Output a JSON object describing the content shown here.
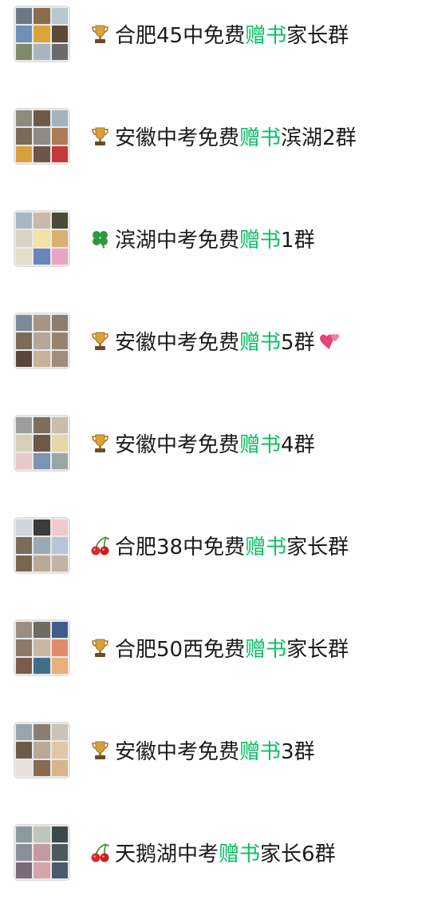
{
  "groups": [
    {
      "emoji": "trophy-icon",
      "pre": "合肥45中免费",
      "hl": "赠书",
      "post": "家长群",
      "suffix": "",
      "tiles": [
        "#6b7a86",
        "#8a6d4b",
        "#b9c7cf",
        "#6e8fb8",
        "#d9a53a",
        "#5a4a3a",
        "#7e8a6a",
        "#a9b4bf",
        "#6b6b6b"
      ]
    },
    {
      "emoji": "trophy-icon",
      "pre": "安徽中考免费",
      "hl": "赠书",
      "post": "滨湖2群",
      "suffix": "",
      "tiles": [
        "#8f8a7a",
        "#6f5a4a",
        "#a3b3c0",
        "#7a6a58",
        "#8c8c84",
        "#b07a55",
        "#d8a03a",
        "#6d5648",
        "#c23a3a"
      ]
    },
    {
      "emoji": "clover-icon",
      "pre": "滨湖中考免费",
      "hl": "赠书",
      "post": "1群",
      "suffix": "",
      "tiles": [
        "#a7b6c3",
        "#c9b9a7",
        "#4a4a3a",
        "#d7d2c4",
        "#f1e3a8",
        "#d8b070",
        "#e5ddc9",
        "#6a86b8",
        "#e7a6c4"
      ]
    },
    {
      "emoji": "trophy-icon",
      "pre": "安徽中考免费",
      "hl": "赠书",
      "post": "5群",
      "suffix": "two-hearts-icon",
      "tiles": [
        "#7a8a98",
        "#a49584",
        "#8b7d70",
        "#7c6a5a",
        "#b3a79a",
        "#96836f",
        "#5a4636",
        "#c7b19a",
        "#a08c7a"
      ]
    },
    {
      "emoji": "trophy-icon",
      "pre": "安徽中考免费",
      "hl": "赠书",
      "post": "4群",
      "suffix": "",
      "tiles": [
        "#9a9f9a",
        "#7d6e5e",
        "#c8bda8",
        "#d9cfb8",
        "#6a5a4a",
        "#e6d7a6",
        "#e9c7c8",
        "#7e93b0",
        "#9aa5a8"
      ]
    },
    {
      "emoji": "cherries-icon",
      "pre": "合肥38中免费",
      "hl": "赠书",
      "post": "家长群",
      "suffix": "",
      "tiles": [
        "#cfd5d8",
        "#3b3b3b",
        "#f0c9cf",
        "#7c6a5a",
        "#9aa9b5",
        "#b7c6d6",
        "#7a6650",
        "#b9a996",
        "#c3b3a4"
      ]
    },
    {
      "emoji": "trophy-icon",
      "pre": "合肥50西免费",
      "hl": "赠书",
      "post": "家长群",
      "suffix": "",
      "tiles": [
        "#9a8e80",
        "#6f6a62",
        "#3f5f8a",
        "#8c7a6a",
        "#c7b8a4",
        "#e08a6a",
        "#7a5c4a",
        "#3f6f8f",
        "#e7b07a"
      ]
    },
    {
      "emoji": "trophy-icon",
      "pre": "安徽中考免费",
      "hl": "赠书",
      "post": "3群",
      "suffix": "",
      "tiles": [
        "#9aa4ac",
        "#8a7e72",
        "#c9c3b9",
        "#6a5a4a",
        "#b8a996",
        "#e0c7a8",
        "#e8e0d8",
        "#8a6a50",
        "#d7b48a"
      ]
    },
    {
      "emoji": "cherries-icon",
      "pre": "天鹅湖中考",
      "hl": "赠书",
      "post": "家长6群",
      "suffix": "",
      "tiles": [
        "#8a9a9e",
        "#bfc5b8",
        "#3b4a4a",
        "#8a8f9a",
        "#c29aa0",
        "#4d5a5a",
        "#7a6a7a",
        "#d6a3a8",
        "#4a5a6a"
      ]
    }
  ]
}
